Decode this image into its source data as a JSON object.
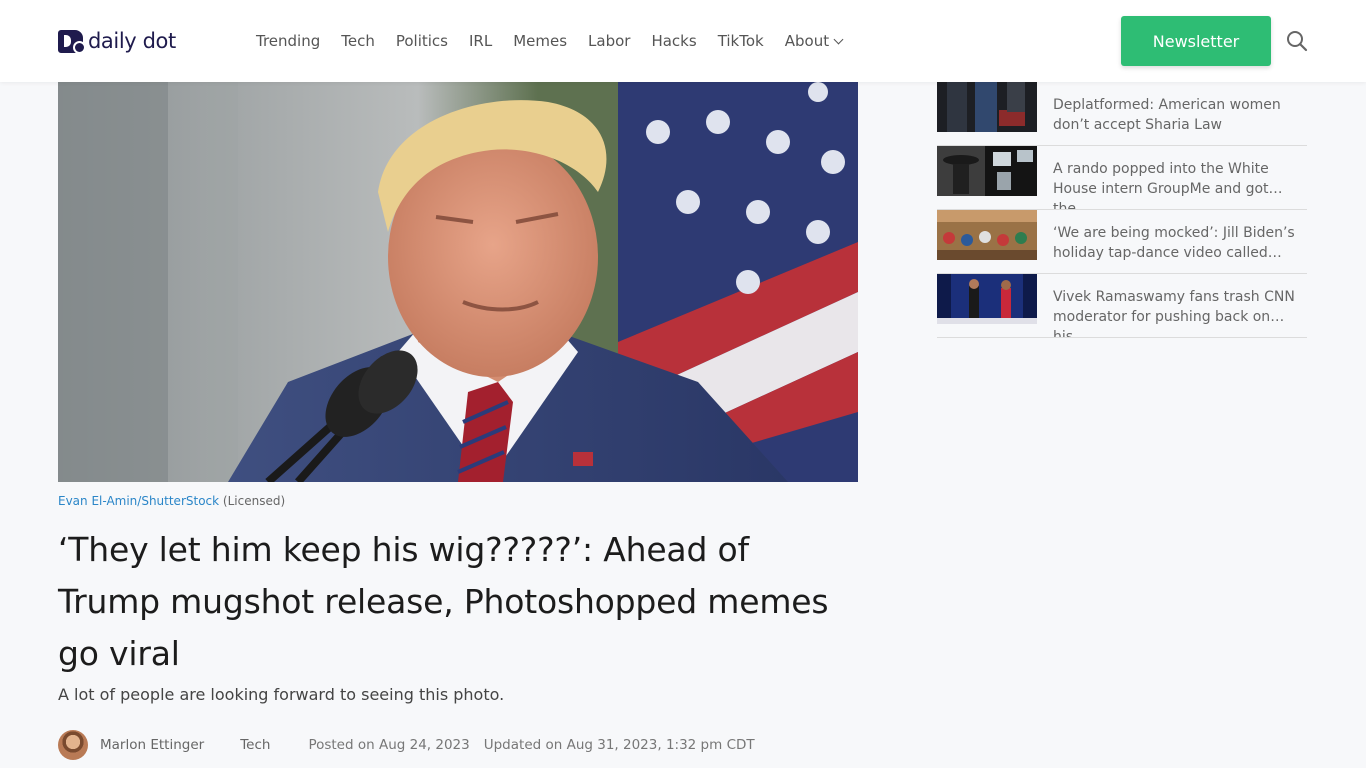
{
  "brand": {
    "name": "daily dot"
  },
  "nav": {
    "items": [
      "Trending",
      "Tech",
      "Politics",
      "IRL",
      "Memes",
      "Labor",
      "Hacks",
      "TikTok"
    ],
    "about_label": "About"
  },
  "header": {
    "newsletter_label": "Newsletter"
  },
  "article": {
    "image_credit_name": "Evan El-Amin/ShutterStock",
    "image_credit_license": "(Licensed)",
    "title": "‘They let him keep his wig?????’: Ahead of Trump mugshot release, Photoshopped memes go viral",
    "dek": "A lot of people are looking forward to seeing this photo.",
    "author": "Marlon Ettinger",
    "category": "Tech",
    "posted": "Posted on Aug 24, 2023",
    "updated": "Updated on Aug 31, 2023, 1:32 pm CDT"
  },
  "sidebar": {
    "items": [
      {
        "title": "Deplatformed: American women don’t accept Sharia Law"
      },
      {
        "title": "A rando popped into the White House intern GroupMe and got the…"
      },
      {
        "title": "‘We are being mocked’: Jill Biden’s holiday tap-dance video called…"
      },
      {
        "title": "Vivek Ramaswamy fans trash CNN moderator for pushing back on his…"
      }
    ]
  },
  "colors": {
    "accent": "#2ebd74",
    "brand": "#1f1b4d",
    "link": "#2b86c8"
  },
  "icons": {
    "search": "search-icon",
    "about_chevron": "chevron-down-icon"
  }
}
